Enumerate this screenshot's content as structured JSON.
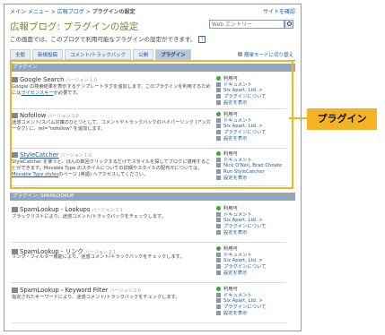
{
  "topbar": {
    "breadcrumb_1": "メイン メニュー",
    "breadcrumb_2": "広報ブログ",
    "breadcrumb_3": "プラグインの設定",
    "site_link": "サイトを確認"
  },
  "page": {
    "title": "広報ブログ: プラグインの設定",
    "description": "この画面では、このブログで利用可能なプラグインの設定ができます。",
    "search_placeholder": "Web エントリー"
  },
  "tabs": [
    "全般",
    "新規投稿",
    "コメント/トラックバック",
    "公開",
    "プラグイン"
  ],
  "active_tab": "プラグイン",
  "mode_link": "簡単モードに切り替え",
  "sections": [
    {
      "title": "プラグイン",
      "plugins": [
        {
          "name": "Google Search",
          "version": "バージョン 1.0",
          "desc_parts": [
            "Google の検索結果を表示するテンプレートタグを追加します。このプラグインを利用するためには",
            "ライセンスキー",
            "が必要です。"
          ],
          "status": "利用可",
          "links": [
            "ドキュメント",
            "Six Apart, Ltd.",
            "プラグインについて",
            "設定を表示"
          ]
        },
        {
          "name": "Nofollow",
          "version": "バージョン 1.0",
          "desc_parts": [
            "迷惑コメント/スパム対策のひとつとして、コメントやトラックバックのハイパーリンク (アンカータグ) に、rel=\"nofollow\" を追加します。",
            "",
            ""
          ],
          "status": "利用可",
          "links": [
            "ドキュメント",
            "Six Apart, Ltd.",
            "プラグインについて",
            "設定を表示"
          ]
        },
        {
          "name": "StyleCatcher",
          "version": "バージョン 1.0",
          "desc_parts": [
            "StyleCatcher を使うと、ほんの数回クリックするだけでスタイルを探してブログに適用することができます。Movable Type のスタイルについての詳細やスタイルの配布元については、",
            "Movable Type styles",
            "のページ (英語) へアクセスしてください。"
          ],
          "status": "利用可",
          "links": [
            "ドキュメント",
            "Nick O'Neil, Brad Choate",
            "Run StyleCatcher",
            "設定を表示"
          ]
        }
      ]
    },
    {
      "title": "プラグイン: SPAMLOOKUP",
      "plugins": [
        {
          "name": "SpamLookup - Lookups",
          "version": "バージョン 2.1",
          "desc_parts": [
            "ブラックリストにより、迷惑コメント/トラックバックをチェックします。",
            "",
            ""
          ],
          "status": "利用可",
          "links": [
            "ドキュメント",
            "Six Apart, Ltd.",
            "プラグインについて",
            "設定を表示"
          ]
        },
        {
          "name": "SpamLookup - リンク",
          "version": "バージョン 2.1",
          "desc_parts": [
            "リンク・フィルター機能により、迷惑コメント/トラックバックをチェックします。",
            "",
            ""
          ],
          "status": "利用可",
          "links": [
            "ドキュメント",
            "Six Apart, Ltd.",
            "プラグインについて",
            "設定を表示"
          ]
        },
        {
          "name": "SpamLookup - Keyword Filter",
          "version": "バージョン 2.0",
          "desc_parts": [
            "指定されたキーワードにより、迷惑コメント/トラックバックをチェックします。",
            "",
            ""
          ],
          "status": "利用可",
          "links": [
            "ドキュメント",
            "Six Apart, Ltd.",
            "プラグインについて",
            "設定を表示"
          ]
        }
      ]
    }
  ],
  "callout": "プラグイン",
  "colors": {
    "title_green": "#6e8b2a",
    "section_header": "#94a6ba",
    "highlight": "#f4b324",
    "link": "#1a5a9a",
    "status_dot": "#3aa835"
  }
}
